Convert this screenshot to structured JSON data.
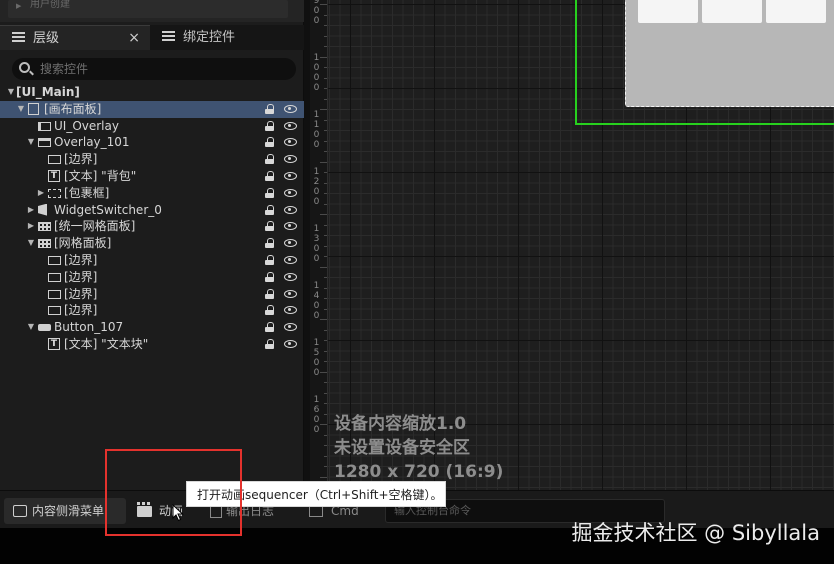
{
  "top_partial_category": "用户创建",
  "tabs": {
    "hierarchy": "层级",
    "hierarchy_close": "×",
    "bind_widgets": "绑定控件"
  },
  "search": {
    "placeholder": "搜索控件"
  },
  "tree": [
    {
      "label": "[UI_Main]",
      "icon": "none",
      "depth": 0,
      "expanded": true,
      "selected": false,
      "lock": false,
      "eye": false
    },
    {
      "label": "[画布面板]",
      "icon": "canvas-panel-icon",
      "depth": 1,
      "expanded": true,
      "selected": true,
      "lock": true,
      "eye": true
    },
    {
      "label": "UI_Overlay",
      "icon": "user-widget-icon",
      "depth": 2,
      "expanded": null,
      "selected": false,
      "lock": true,
      "eye": true
    },
    {
      "label": "Overlay_101",
      "icon": "overlay-icon",
      "depth": 2,
      "expanded": true,
      "selected": false,
      "lock": true,
      "eye": true
    },
    {
      "label": "[边界]",
      "icon": "border-icon",
      "depth": 3,
      "expanded": null,
      "selected": false,
      "lock": true,
      "eye": true
    },
    {
      "label": "[文本] \"背包\"",
      "icon": "text-icon",
      "depth": 3,
      "expanded": null,
      "selected": false,
      "lock": true,
      "eye": true
    },
    {
      "label": "[包裹框]",
      "icon": "wrap-box-icon",
      "depth": 3,
      "expanded": false,
      "selected": false,
      "lock": true,
      "eye": true
    },
    {
      "label": "WidgetSwitcher_0",
      "icon": "widget-switcher-icon",
      "depth": 2,
      "expanded": false,
      "selected": false,
      "lock": true,
      "eye": true
    },
    {
      "label": "[统一网格面板]",
      "icon": "uniform-grid-icon",
      "depth": 2,
      "expanded": false,
      "selected": false,
      "lock": true,
      "eye": true
    },
    {
      "label": "[网格面板]",
      "icon": "grid-panel-icon",
      "depth": 2,
      "expanded": true,
      "selected": false,
      "lock": true,
      "eye": true
    },
    {
      "label": "[边界]",
      "icon": "border-icon",
      "depth": 3,
      "expanded": null,
      "selected": false,
      "lock": true,
      "eye": true
    },
    {
      "label": "[边界]",
      "icon": "border-icon",
      "depth": 3,
      "expanded": null,
      "selected": false,
      "lock": true,
      "eye": true
    },
    {
      "label": "[边界]",
      "icon": "border-icon",
      "depth": 3,
      "expanded": null,
      "selected": false,
      "lock": true,
      "eye": true
    },
    {
      "label": "[边界]",
      "icon": "border-icon",
      "depth": 3,
      "expanded": null,
      "selected": false,
      "lock": true,
      "eye": true
    },
    {
      "label": "Button_107",
      "icon": "button-icon",
      "depth": 2,
      "expanded": true,
      "selected": false,
      "lock": true,
      "eye": true
    },
    {
      "label": "[文本] \"文本块\"",
      "icon": "text-icon",
      "depth": 3,
      "expanded": null,
      "selected": false,
      "lock": true,
      "eye": true
    }
  ],
  "ruler_labels": [
    "9\n0\n0",
    "1\n0\n0\n0",
    "1\n1\n0\n0",
    "1\n2\n0\n0",
    "1\n3\n0\n0",
    "1\n4\n0\n0",
    "1\n5\n0\n0",
    "1\n6\n0\n0"
  ],
  "canvas": {
    "dpi_scale": "设备内容缩放1.0",
    "safe_zone": "未设置设备安全区",
    "resolution": "1280 x 720 (16:9)"
  },
  "bottom_bar": {
    "content_drawer": "内容侧滑菜单",
    "animation": "动画",
    "output_log": "输出日志",
    "cmd": "Cmd",
    "console_placeholder": "输入控制台命令"
  },
  "tooltip": "打开动画sequencer（Ctrl+Shift+空格键）。",
  "watermark": "掘金技术社区 @ Sibyllala",
  "colors": {
    "selection": "#3f5372",
    "design_frame": "#27d11e",
    "highlight_box": "#e4322d"
  }
}
